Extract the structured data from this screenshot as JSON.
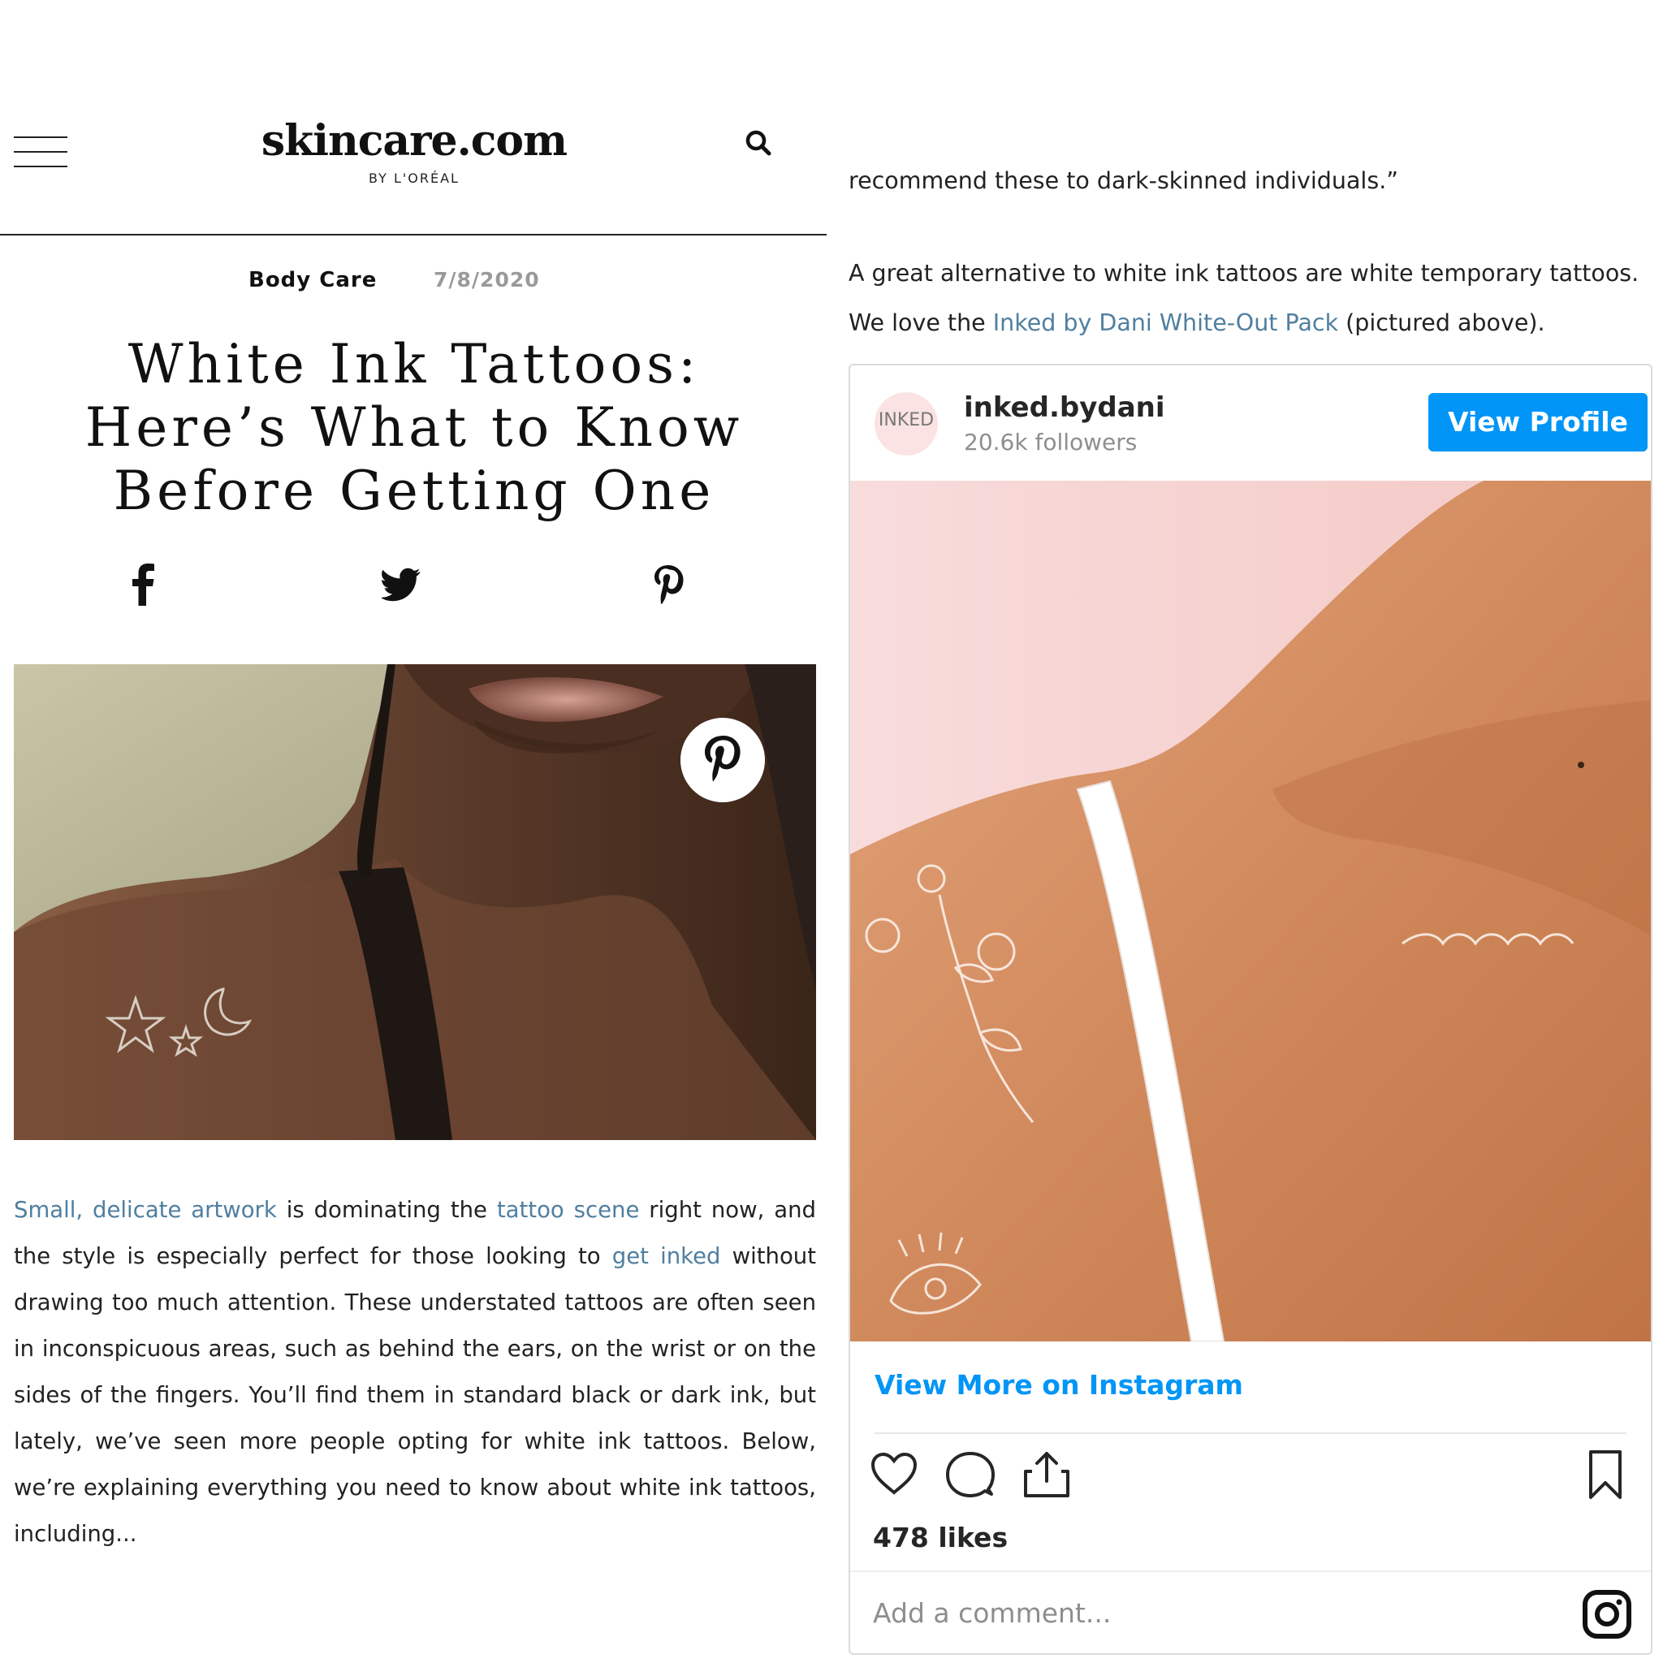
{
  "site": {
    "logo_main": "skincare.com",
    "logo_sub": "BY L'ORÉAL"
  },
  "article": {
    "category": "Body Care",
    "date": "7/8/2020",
    "headline": "White Ink Tattoos: Here’s What to Know Before Getting One",
    "share_icons": [
      "facebook-icon",
      "twitter-icon",
      "pinterest-icon"
    ],
    "body": {
      "link1": "Small, delicate artwork",
      "t1": " is dominating the ",
      "link2": "tattoo scene",
      "t2": " right now, and the style is especially perfect for those looking to ",
      "link3": "get inked",
      "t3": " without drawing too much attention. These understated tattoos are often seen in inconspicuous areas, such as behind the ears, on the wrist or on the sides of the fingers. You’ll find them in standard black or dark ink, but lately, we’ve seen more people opting for white ink tattoos. Below, we’re explaining everything you need to know about white ink tattoos, including..."
    }
  },
  "right": {
    "line1": "recommend these to dark-skinned individuals.”",
    "line2": "A great alternative to white ink tattoos are white temporary tattoos.",
    "line3_pre": "We love the ",
    "line3_link": "Inked by Dani White-Out Pack",
    "line3_post": " (pictured above)."
  },
  "instagram": {
    "avatar_text": "INKED",
    "username": "inked.bydani",
    "followers": "20.6k followers",
    "view_profile": "View Profile",
    "view_more": "View More on Instagram",
    "likes": "478 likes",
    "comment_placeholder": "Add a comment...",
    "accent_color": "#0095f6"
  },
  "colors": {
    "link": "#4f7fa0",
    "date_gray": "#9a9a9a"
  }
}
